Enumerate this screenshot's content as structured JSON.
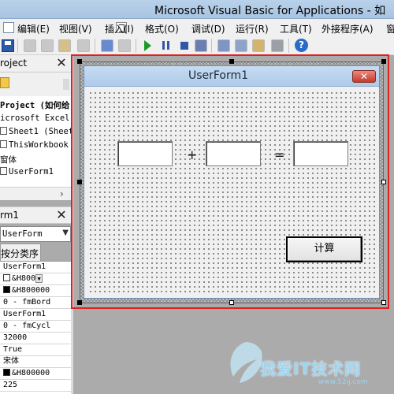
{
  "window": {
    "title": "Microsoft Visual Basic for Applications - 如"
  },
  "menu": [
    "编辑(E)",
    "视图(V)",
    "插入(I)",
    "格式(O)",
    "调试(D)",
    "运行(R)",
    "工具(T)",
    "外接程序(A)",
    "窗"
  ],
  "icons": {
    "save": "save-icon",
    "cut": "cut-icon",
    "copy": "copy-icon",
    "paste": "paste-icon",
    "find": "find-icon",
    "undo": "undo-icon",
    "redo": "redo-icon",
    "run": "run-icon",
    "pause": "pause-icon",
    "stop": "stop-icon",
    "design": "design-mode-icon",
    "project": "project-explorer-icon",
    "properties": "properties-icon",
    "object_browser": "object-browser-icon",
    "toolbox": "toolbox-icon",
    "help": "help-icon"
  },
  "colors": {
    "highlight": "#e02020",
    "run": "#1a9a2a",
    "accent": "#3456a8",
    "close": "#c43b2a"
  },
  "project_panel": {
    "title": "roject",
    "tree": [
      {
        "text": "Project (如何给",
        "bold": true
      },
      {
        "text": "icrosoft Excel"
      },
      {
        "text": "Sheet1 (Sheet",
        "icon": true
      },
      {
        "text": "ThisWorkbook",
        "icon": true
      },
      {
        "text": "窗体"
      },
      {
        "text": "UserForm1",
        "icon": true
      }
    ],
    "close_glyph": "✕"
  },
  "properties_panel": {
    "title": "rm1",
    "object": "UserForm",
    "tab": "按分类序",
    "rows": [
      {
        "text": "UserForm1"
      },
      {
        "text": "&H800",
        "swatch": "white",
        "drop": true
      },
      {
        "text": "&H800000",
        "swatch": "black"
      },
      {
        "text": "0 - fmBord"
      },
      {
        "text": "UserForm1"
      },
      {
        "text": "0 - fmCycl"
      },
      {
        "text": "32000"
      },
      {
        "text": "True"
      },
      {
        "text": "宋体"
      },
      {
        "text": "&H800000",
        "swatch": "black"
      },
      {
        "text": "225"
      }
    ],
    "close_glyph": "✕"
  },
  "userform": {
    "title": "UserForm1",
    "close_glyph": "✕",
    "plus": "+",
    "equals": "=",
    "textbox1": "",
    "textbox2": "",
    "result": "",
    "calculate_label": "计算"
  },
  "help_glyph": "?",
  "scroll_right_glyph": "›",
  "combo_drop_glyph": "▼",
  "watermark": {
    "text": "我爱IT技术网",
    "url": "www.52ij.com"
  }
}
